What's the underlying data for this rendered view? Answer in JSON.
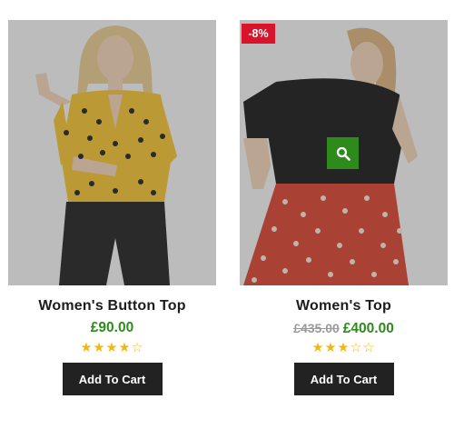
{
  "products": [
    {
      "name": "Women's Button Top",
      "price": "£90.00",
      "old_price": "",
      "badge": "",
      "rating": 4,
      "rating_max": 5,
      "button_label": "Add To Cart"
    },
    {
      "name": "Women's Top",
      "price": "£400.00",
      "old_price": "£435.00",
      "badge": "-8%",
      "rating": 3,
      "rating_max": 5,
      "button_label": "Add To Cart",
      "quick_view_icon": "search-icon"
    }
  ],
  "colors": {
    "price_green": "#2e8b1b",
    "badge_red": "#d8132a",
    "button_dark": "#222222",
    "star_gold": "#f2b714"
  }
}
